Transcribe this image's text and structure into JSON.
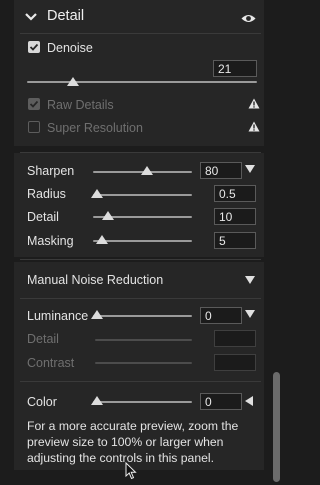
{
  "header": {
    "title": "Detail",
    "eye_icon": "eye-icon",
    "collapse_icon": "chevron-down-icon"
  },
  "denoise": {
    "label": "Denoise",
    "checked": true,
    "value": "21",
    "slider_fraction": 0.21
  },
  "options": [
    {
      "label": "Raw Details",
      "checked": true,
      "enabled": false,
      "warning": true
    },
    {
      "label": "Super Resolution",
      "checked": false,
      "enabled": false,
      "warning": true
    }
  ],
  "sharpen": {
    "sharpen": {
      "label": "Sharpen",
      "value": "80"
    },
    "radius": {
      "label": "Radius",
      "value": "0.5"
    },
    "detail": {
      "label": "Detail",
      "value": "10"
    },
    "masking": {
      "label": "Masking",
      "value": "5"
    }
  },
  "noise": {
    "title": "Manual Noise Reduction",
    "luminance": {
      "label": "Luminance",
      "value": "0"
    },
    "lum_detail": {
      "label": "Detail",
      "value": ""
    },
    "lum_contrast": {
      "label": "Contrast",
      "value": ""
    },
    "color": {
      "label": "Color",
      "value": "0"
    }
  },
  "help_text": "For a more accurate preview, zoom the preview size to 100% or larger when adjusting the controls in this panel.",
  "colors": {
    "background": "#1c1c1c",
    "panel": "#262626",
    "checkbox_accent": "#d8d8d8",
    "warning": "#e6e6e6"
  }
}
